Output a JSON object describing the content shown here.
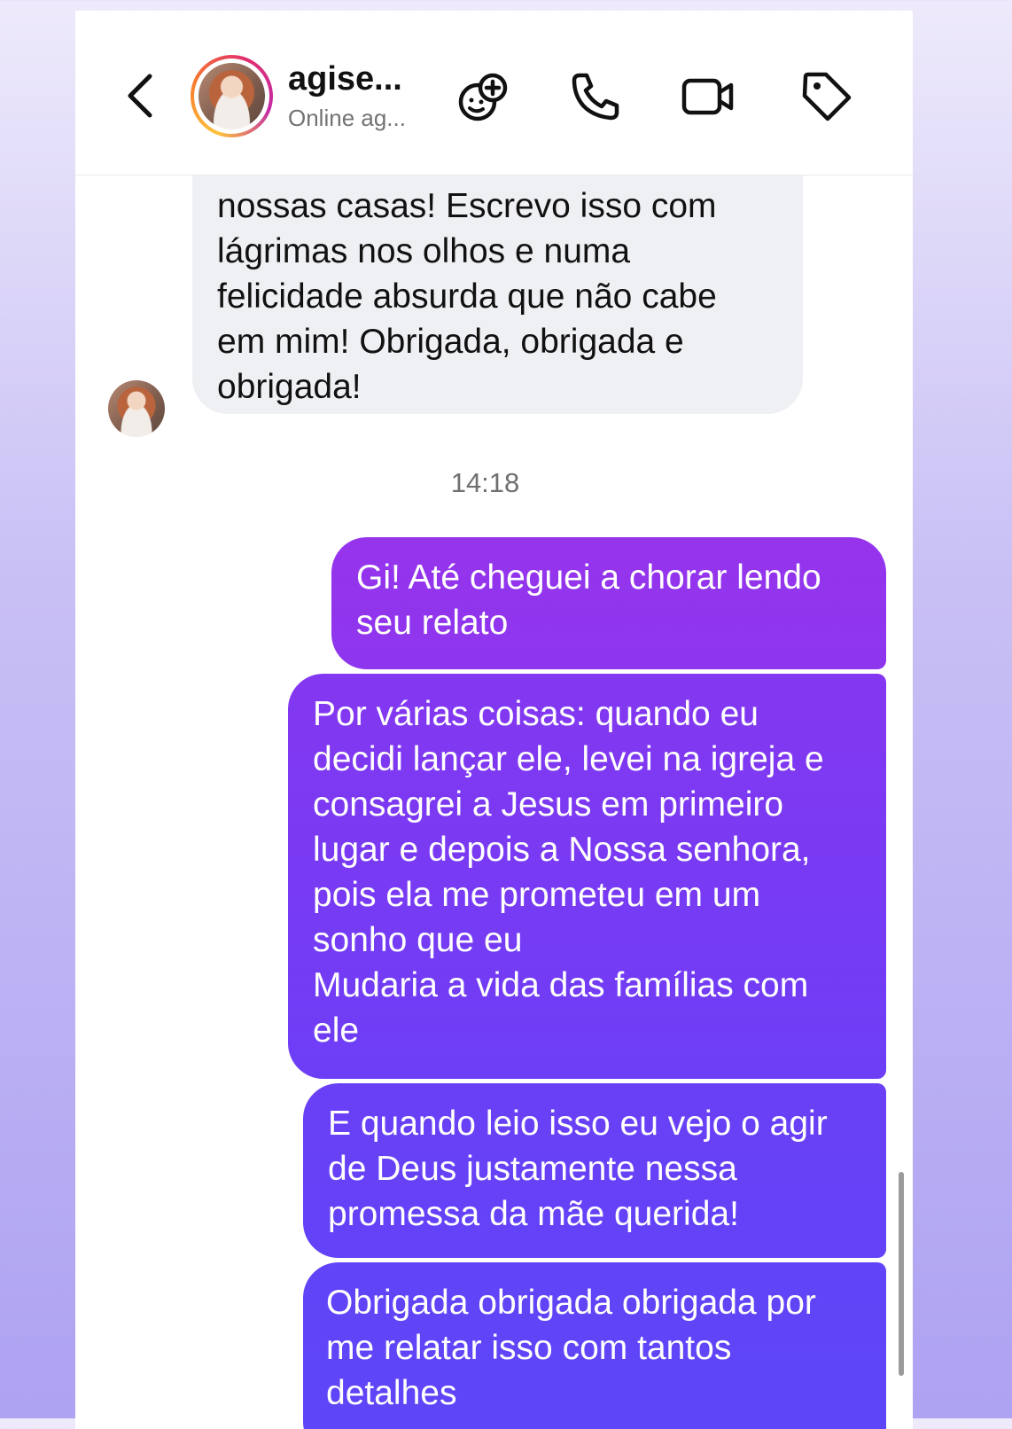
{
  "header": {
    "back_icon": "chevron-left-icon",
    "contact_name": "agise...",
    "status": "Online ag...",
    "actions": [
      {
        "icon": "effects-icon"
      },
      {
        "icon": "phone-icon"
      },
      {
        "icon": "video-icon"
      },
      {
        "icon": "tag-icon"
      }
    ]
  },
  "messages": {
    "incoming": {
      "text": "nossas casas! Escrevo isso com\nlágrimas nos olhos e numa\nfelicidade absurda que não cabe\nem mim! Obrigada, obrigada e\nobrigada!"
    },
    "timestamp": "14:18",
    "outgoing": [
      {
        "text": "Gi! Até cheguei a chorar lendo\nseu relato"
      },
      {
        "text": "Por várias coisas: quando eu\ndecidi lançar ele, levei na igreja e\nconsagrei a Jesus em primeiro\nlugar e depois a Nossa senhora,\npois ela me prometeu em um\nsonho que eu\nMudaria a vida das famílias com\nele"
      },
      {
        "text": "E quando leio isso eu vejo o agir\nde Deus justamente nessa\npromessa da mãe querida!"
      },
      {
        "text": "Obrigada obrigada obrigada por\nme relatar isso com tantos\ndetalhes"
      }
    ]
  },
  "colors": {
    "incoming_bubble": "#eff0f3",
    "outgoing_top": "#9634ec",
    "outgoing_bottom": "#5c47f8",
    "background_gradient": "#aea2f2"
  }
}
